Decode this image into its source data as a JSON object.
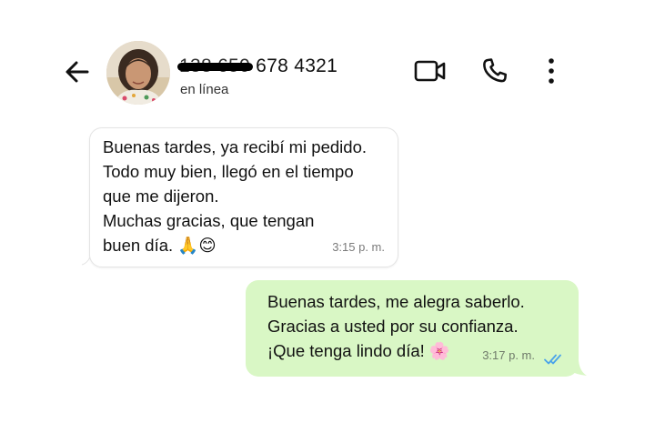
{
  "header": {
    "back_icon": "arrow-left-icon",
    "contact_name_redacted": "138 650",
    "contact_name_visible": "678 4321",
    "status": "en línea",
    "video_icon": "video-camera-icon",
    "call_icon": "phone-icon",
    "more_icon": "more-vertical-icon"
  },
  "messages": [
    {
      "direction": "incoming",
      "text": "Buenas tardes, ya recibí mi pedido.\nTodo muy bien, llegó en el tiempo\nque me dijeron.\nMuchas gracias, que tengan\nbuen día. 🙏😊",
      "time": "3:15 p. m."
    },
    {
      "direction": "outgoing",
      "text": "Buenas tardes, me alegra saberlo.\nGracias a usted por su confianza.\n¡Que tenga lindo día! 🌸",
      "time": "3:17 p. m.",
      "status_icon": "double-check-read-icon"
    }
  ],
  "colors": {
    "outgoing_bubble": "#d9f7c5",
    "incoming_bubble": "#ffffff",
    "read_ticks": "#4aa3ea"
  }
}
